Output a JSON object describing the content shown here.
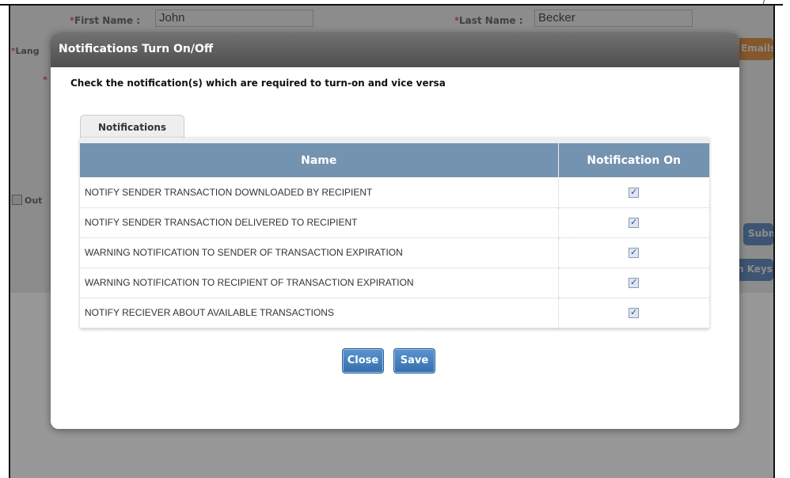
{
  "background_form": {
    "first_name_label": "First Name :",
    "first_name_required": "*",
    "first_name_value": "John",
    "last_name_label": "Last Name :",
    "last_name_required": "*",
    "last_name_value": "Becker",
    "language_label": "Lang",
    "language_required": "*",
    "required_marker": "*",
    "out_label": "Out",
    "emails_button": "Emails",
    "submit_button": "Subm",
    "keys_button": "n Keys",
    "corner_mark": "/"
  },
  "modal": {
    "title": "Notifications Turn On/Off",
    "instruction": "Check the notification(s) which are required to turn-on and vice versa",
    "tab_label": "Notifications",
    "table": {
      "columns": [
        "Name",
        "Notification On"
      ],
      "rows": [
        {
          "name": "NOTIFY SENDER TRANSACTION DOWNLOADED BY RECIPIENT",
          "on": true
        },
        {
          "name": "NOTIFY SENDER TRANSACTION DELIVERED TO RECIPIENT",
          "on": true
        },
        {
          "name": "WARNING NOTIFICATION TO SENDER OF TRANSACTION EXPIRATION",
          "on": true
        },
        {
          "name": "WARNING NOTIFICATION TO RECIPIENT OF TRANSACTION EXPIRATION",
          "on": true
        },
        {
          "name": "NOTIFY RECIEVER ABOUT AVAILABLE TRANSACTIONS",
          "on": true
        }
      ]
    },
    "close_label": "Close",
    "save_label": "Save"
  },
  "colors": {
    "header_bg": "#5c5c5c",
    "table_header_bg": "#7493b0",
    "button_blue": "#3f7bbd",
    "emails_orange": "#f0a050"
  },
  "icons": {
    "checkbox_checked": "check-icon"
  }
}
